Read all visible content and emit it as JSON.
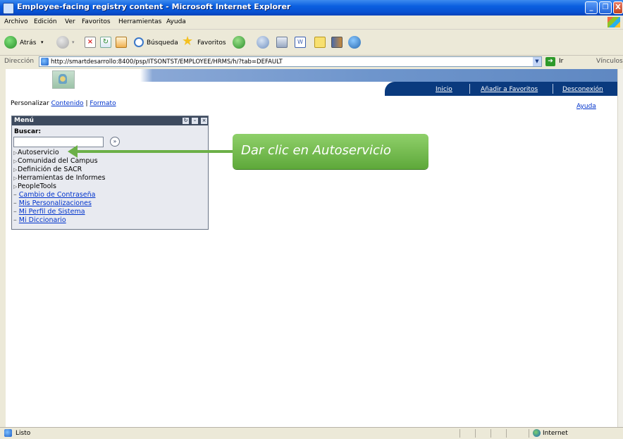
{
  "window": {
    "title": "Employee-facing registry content - Microsoft Internet Explorer",
    "min_label": "_",
    "max_label": "❐",
    "close_label": "X"
  },
  "menubar": [
    "Archivo",
    "Edición",
    "Ver",
    "Favoritos",
    "Herramientas",
    "Ayuda"
  ],
  "toolbar": {
    "back_label": "Atrás",
    "search_label": "Búsqueda",
    "favorites_label": "Favoritos"
  },
  "address": {
    "label": "Dirección",
    "url": "http://smartdesarrollo:8400/psp/ITSONTST/EMPLOYEE/HRMS/h/?tab=DEFAULT",
    "go_label": "Ir",
    "links_label": "Vínculos"
  },
  "page": {
    "nav": [
      "Inicio",
      "Añadir a Favoritos",
      "Desconexión"
    ],
    "personalize_prefix": "Personalizar",
    "personalize_content": "Contenido",
    "personalize_sep": "|",
    "personalize_format": "Formato",
    "help": "Ayuda"
  },
  "menu_portlet": {
    "title": "Menú",
    "search_label": "Buscar:",
    "search_value": "",
    "search_go": "»",
    "folders": [
      "Autoservicio",
      "Comunidad del Campus",
      "Definición de SACR",
      "Herramientas de Informes",
      "PeopleTools"
    ],
    "links": [
      "Cambio de Contraseña",
      "Mis Personalizaciones",
      "Mi Perfil de Sistema",
      "Mi Diccionario"
    ]
  },
  "callout": {
    "text": "Dar clic en Autoservicio",
    "color": "#6cb048"
  },
  "statusbar": {
    "status": "Listo",
    "zone": "Internet"
  }
}
